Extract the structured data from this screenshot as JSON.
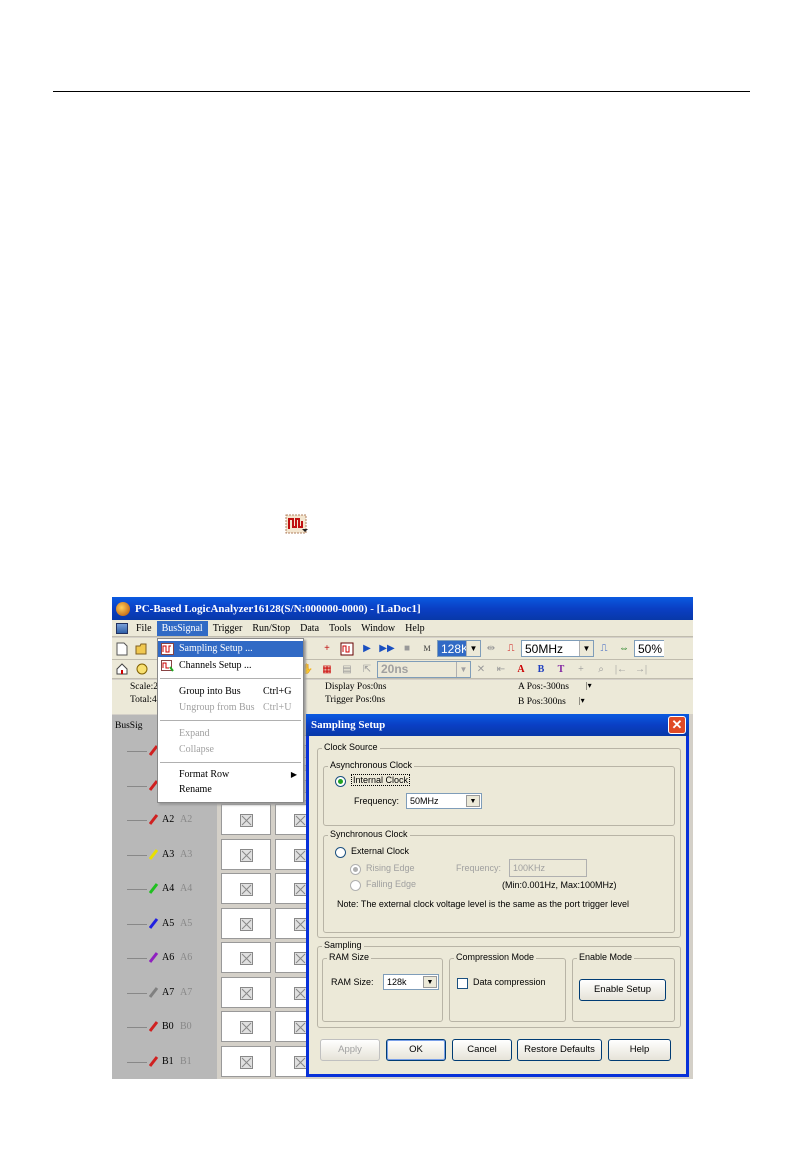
{
  "app": {
    "title": "PC-Based LogicAnalyzer16128(S/N:000000-0000) - [LaDoc1]",
    "menu": [
      "File",
      "BusSignal",
      "Trigger",
      "Run/Stop",
      "Data",
      "Tools",
      "Window",
      "Help"
    ],
    "toolbar1": {
      "ram_size": "128K",
      "frequency": "50MHz",
      "trigger_percent": "50%"
    },
    "toolbar2": {
      "time_per_div": "20ns",
      "cursor_buttons": [
        "A",
        "B",
        "T",
        "+"
      ]
    },
    "info": {
      "scale_label": "Scale:2",
      "total_label": "Total:4",
      "display_pos": "Display Pos:0ns",
      "trigger_pos": "Trigger Pos:0ns",
      "a_pos": "A Pos:-300ns",
      "b_pos": "B Pos:300ns"
    },
    "bus_header": "BusSig",
    "signals": [
      {
        "name": "A2",
        "alias": "A2",
        "color": "#d02020"
      },
      {
        "name": "A3",
        "alias": "A3",
        "color": "#e8e000"
      },
      {
        "name": "A4",
        "alias": "A4",
        "color": "#20c020"
      },
      {
        "name": "A5",
        "alias": "A5",
        "color": "#2020e0"
      },
      {
        "name": "A6",
        "alias": "A6",
        "color": "#9020c0"
      },
      {
        "name": "A7",
        "alias": "A7",
        "color": "#808080"
      },
      {
        "name": "B0",
        "alias": "B0",
        "color": "#d02020"
      },
      {
        "name": "B1",
        "alias": "B1",
        "color": "#d02020"
      }
    ]
  },
  "menu_dropdown": {
    "items": [
      {
        "label": "Sampling Setup ...",
        "shortcut": "",
        "state": "highlighted"
      },
      {
        "label": "Channels Setup ...",
        "shortcut": "",
        "state": "normal"
      },
      {
        "label": "Group into Bus",
        "shortcut": "Ctrl+G",
        "state": "normal"
      },
      {
        "label": "Ungroup from Bus",
        "shortcut": "Ctrl+U",
        "state": "disabled"
      },
      {
        "label": "Expand",
        "shortcut": "",
        "state": "disabled"
      },
      {
        "label": "Collapse",
        "shortcut": "",
        "state": "disabled"
      },
      {
        "label": "Format Row",
        "shortcut": "",
        "state": "submenu"
      },
      {
        "label": "Rename",
        "shortcut": "",
        "state": "normal"
      }
    ]
  },
  "dialog": {
    "title": "Sampling Setup",
    "clock_source": {
      "label": "Clock Source",
      "async_group": "Asynchronous Clock",
      "internal_clock": "Internal Clock",
      "frequency_label": "Frequency:",
      "frequency_value": "50MHz",
      "sync_group": "Synchronous Clock",
      "external_clock": "External Clock",
      "rising_edge": "Rising Edge",
      "falling_edge": "Falling Edge",
      "ext_frequency_label": "Frequency:",
      "ext_frequency_value": "100KHz",
      "range_note": "(Min:0.001Hz, Max:100MHz)",
      "note": "Note: The external clock voltage level is the same as the port trigger level"
    },
    "sampling": {
      "label": "Sampling",
      "ram_group": "RAM Size",
      "ram_label": "RAM Size:",
      "ram_value": "128k",
      "compression_group": "Compression Mode",
      "data_compression": "Data compression",
      "enable_group": "Enable Mode",
      "enable_setup": "Enable Setup"
    },
    "buttons": {
      "apply": "Apply",
      "ok": "OK",
      "cancel": "Cancel",
      "restore": "Restore Defaults",
      "help": "Help"
    }
  },
  "colors": {
    "titlebar": "#0a3fc4",
    "highlight": "#316ac5",
    "dialog_bg": "#ece9d8"
  }
}
